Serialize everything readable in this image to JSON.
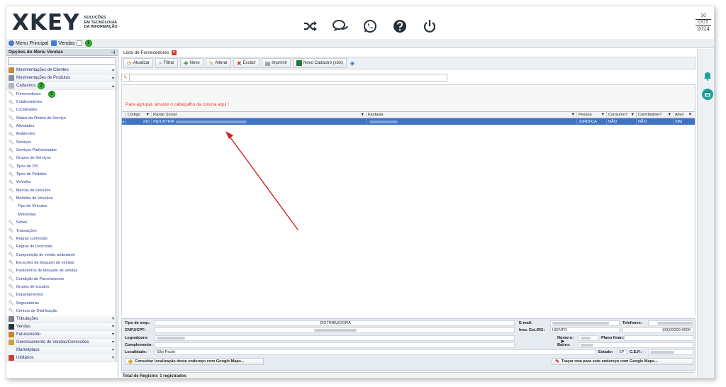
{
  "brand": {
    "logo_text": "XKEY",
    "tagline_1": "SOLUÇÕES",
    "tagline_2": "EM TECNOLOGIA",
    "tagline_3": "DA INFORMAÇÃO"
  },
  "date": {
    "day": "10",
    "month": "OUT",
    "year": "2024"
  },
  "header_icons": [
    "shuffle-icon",
    "chat-icon",
    "whatsapp-icon",
    "help-icon",
    "power-icon"
  ],
  "tabs": {
    "menu_principal": "Menu Principal",
    "vendas": "Vendas",
    "badge_1": "1"
  },
  "sidebar": {
    "title": "Opções do Menu Vendas",
    "groups_top": [
      {
        "label": "Movimentações de Clientes"
      },
      {
        "label": "Movimentações de Produtos"
      }
    ],
    "cadastros": {
      "label": "Cadastros",
      "badge": "2",
      "badge_3": "3"
    },
    "items": [
      "Fornecedores:",
      "Colaboradores",
      "Localidades",
      "Status da Ordem de Serviço",
      "Atividades",
      "Ambientes",
      "Serviços",
      "Serviços Padronizados",
      "Grupos de Serviços",
      "Tipos de OS",
      "Tipos de Pedidos",
      "Veículos",
      "Marcas de Veículos",
      "Modelos de Veículos",
      "Tipo de Veículos",
      "Motoristas",
      "Séries",
      "Transações",
      "Regras Comissão",
      "Regras de Desconto",
      "Composição de venda ambulante",
      "Exceções de bloqueio de vendas",
      "Parâmetros de bloqueio de vendas",
      "Condição de Parcelamento",
      "Grupos de Usuário",
      "Departamentos",
      "Seguradoras",
      "Centros de Distribuição"
    ],
    "groups_bottom": [
      {
        "label": "Tributações"
      },
      {
        "label": "Vendas"
      },
      {
        "label": "Faturamento"
      },
      {
        "label": "Gerenciamento de Vendas/Comissões"
      },
      {
        "label": "Marketplace"
      },
      {
        "label": "Utilitários"
      }
    ]
  },
  "main": {
    "doc_tab": "Lista de Fornecedores",
    "toolbar": {
      "atualizar": "Atualizar",
      "filtrar": "Filtrar",
      "novo": "Novo",
      "alterar": "Alterar",
      "excluir": "Excluir",
      "imprimir": "Imprimir",
      "novo_cadastro": "Novo Cadastro (xlsx)"
    },
    "group_hint": "Para agrupar, arraste o cabeçalho da coluna aqui !",
    "columns": [
      "Código",
      "Razão Social",
      "Fantasia",
      "Pessoa",
      "Consumo?",
      "Contribuinte?",
      "Ativo"
    ],
    "row": {
      "codigo": "210",
      "razao": "INDUSTRIA",
      "pessoa": "JURIDICA",
      "consumo": "NÃO",
      "contribuinte": "NÃO",
      "ativo": "SIM"
    }
  },
  "detail": {
    "tipo_emp_label": "Tipo de emp.:",
    "tipo_emp_value": "DISTRIBUIDORA",
    "cnpj_label": "CNPJ/CPF:",
    "email_label": "E-mail:",
    "telefones_label": "Telefones:",
    "insc_label": "Insc. Est./RG:",
    "insc_value": "ISENTO",
    "telefone2_value": "(00)00000-0000",
    "logradouro_label": "Logradouro:",
    "numero_label": "Número:",
    "plano_label": "Plano finan:",
    "complemento_label": "Complemento:",
    "bairro_label": "Bairro:",
    "localidade_label": "Localidade:",
    "localidade_value": "São Paulo",
    "estado_label": "Estado:",
    "estado_value": "SP",
    "cep_label": "C.E.P.:",
    "maps_button": "Consultar localização deste endereço com Google Maps...",
    "rota_button": "Traçar rota para este endereço com Google Maps..."
  },
  "status_bar": "Total de Registro: 1 registrados",
  "colors": {
    "selected_row": "#3d73c5",
    "hint_red": "#e53b2c",
    "badge_green": "#2db92d",
    "teal": "#1aa39a",
    "link_blue": "#1e3e9a"
  }
}
